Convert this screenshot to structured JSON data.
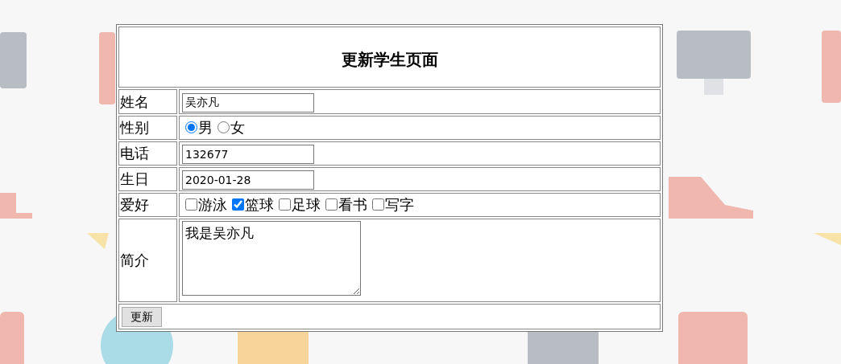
{
  "title": "更新学生页面",
  "fields": [
    {
      "label": "姓名",
      "kind": "text",
      "value": "吴亦凡"
    },
    {
      "label": "性别",
      "kind": "radio",
      "options": [
        {
          "label": "男",
          "selected": true
        },
        {
          "label": "女",
          "selected": false
        }
      ]
    },
    {
      "label": "电话",
      "kind": "text",
      "value": "132677"
    },
    {
      "label": "生日",
      "kind": "text",
      "value": "2020-01-28"
    },
    {
      "label": "爱好",
      "kind": "checkbox",
      "options": [
        {
          "label": "游泳",
          "checked": false
        },
        {
          "label": "篮球",
          "checked": true
        },
        {
          "label": "足球",
          "checked": false
        },
        {
          "label": "看书",
          "checked": false
        },
        {
          "label": "写字",
          "checked": false
        }
      ]
    },
    {
      "label": "简介",
      "kind": "textarea",
      "value": "我是吴亦凡"
    }
  ],
  "submit": "更新"
}
